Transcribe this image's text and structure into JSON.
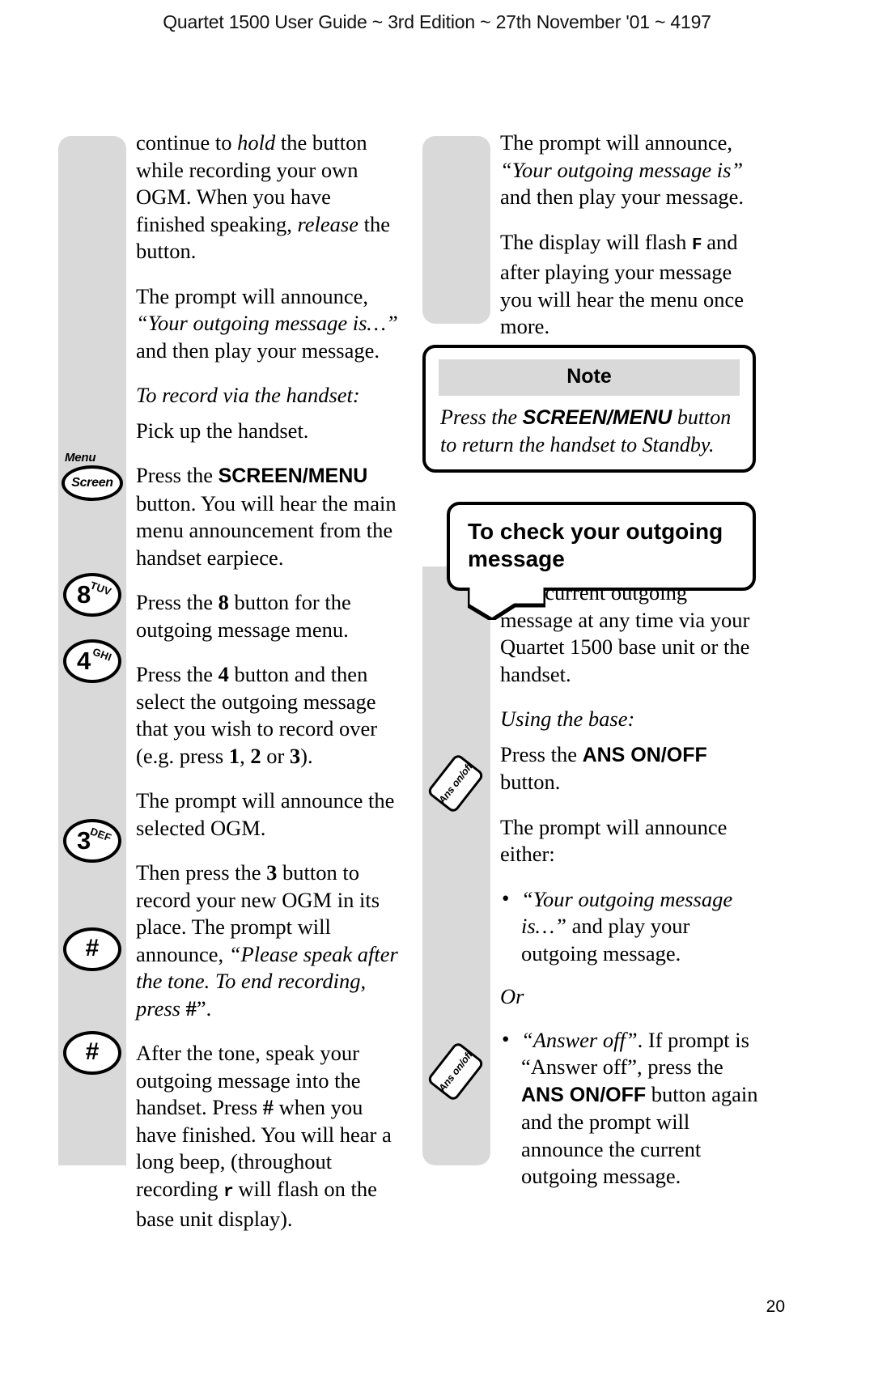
{
  "header": {
    "running_head": "Quartet 1500 User Guide ~ 3rd Edition ~ 27th November '01 ~ 4197"
  },
  "page_number": "20",
  "left_column": {
    "paragraphs": [
      {
        "id": "p1",
        "runs": [
          {
            "text": "continue to ",
            "style": "normal"
          },
          {
            "text": "hold",
            "style": "italic"
          },
          {
            "text": " the button while recording your own OGM. When you have finished speaking, ",
            "style": "normal"
          },
          {
            "text": "release",
            "style": "italic"
          },
          {
            "text": " the button.",
            "style": "normal"
          }
        ]
      },
      {
        "id": "p2",
        "runs": [
          {
            "text": "The prompt will announce, ",
            "style": "normal"
          },
          {
            "text": "“Your outgoing message is…”",
            "style": "italic"
          },
          {
            "text": " and then play your message.",
            "style": "normal"
          }
        ]
      },
      {
        "id": "p3-heading",
        "runs": [
          {
            "text": "To record via the handset:",
            "style": "italic"
          }
        ]
      },
      {
        "id": "p4",
        "runs": [
          {
            "text": "Pick up the handset.",
            "style": "normal"
          }
        ]
      },
      {
        "id": "p5",
        "runs": [
          {
            "text": "Press the ",
            "style": "normal"
          },
          {
            "text": "SCREEN/MENU",
            "style": "sans-bold"
          },
          {
            "text": " button. You will hear the main menu announcement from the handset earpiece.",
            "style": "normal"
          }
        ]
      },
      {
        "id": "p6",
        "runs": [
          {
            "text": "Press the ",
            "style": "normal"
          },
          {
            "text": "8",
            "style": "serif-bold"
          },
          {
            "text": " button for the outgoing message menu.",
            "style": "normal"
          }
        ]
      },
      {
        "id": "p7",
        "runs": [
          {
            "text": "Press the ",
            "style": "normal"
          },
          {
            "text": "4",
            "style": "serif-bold"
          },
          {
            "text": " button and then select the outgoing message that you wish to record over (e.g. press ",
            "style": "normal"
          },
          {
            "text": "1",
            "style": "serif-bold"
          },
          {
            "text": ", ",
            "style": "normal"
          },
          {
            "text": "2",
            "style": "serif-bold"
          },
          {
            "text": " or ",
            "style": "normal"
          },
          {
            "text": "3",
            "style": "serif-bold"
          },
          {
            "text": ").",
            "style": "normal"
          }
        ]
      },
      {
        "id": "p8",
        "runs": [
          {
            "text": "The prompt will announce the selected OGM.",
            "style": "normal"
          }
        ]
      },
      {
        "id": "p9",
        "runs": [
          {
            "text": "Then press the ",
            "style": "normal"
          },
          {
            "text": "3",
            "style": "serif-bold"
          },
          {
            "text": " button to record your new OGM in its place. The prompt will announce, ",
            "style": "normal"
          },
          {
            "text": "“Please speak after the tone. To end recording, press ",
            "style": "italic"
          },
          {
            "text": "#",
            "style": "serif-bold"
          },
          {
            "text": "”.",
            "style": "normal"
          }
        ]
      },
      {
        "id": "p10",
        "runs": [
          {
            "text": "After the tone, speak your outgoing message into the handset. Press ",
            "style": "normal"
          },
          {
            "text": "#",
            "style": "serif-bold"
          },
          {
            "text": " when you have finished. You will hear a long beep, (throughout recording ",
            "style": "normal"
          },
          {
            "text": "r",
            "style": "lcd"
          },
          {
            "text": " will flash on the base unit display).",
            "style": "normal"
          }
        ]
      }
    ],
    "icons": [
      {
        "name": "menu-screen-button-icon",
        "label_top": "Menu",
        "label_oval": "Screen"
      },
      {
        "name": "key-8-icon",
        "digit": "8",
        "letters": "TUV"
      },
      {
        "name": "key-4-icon",
        "digit": "4",
        "letters": "GHI"
      },
      {
        "name": "key-3-icon",
        "digit": "3",
        "letters": "DEF"
      },
      {
        "name": "key-hash-icon",
        "digit": "#",
        "letters": ""
      },
      {
        "name": "key-hash-icon",
        "digit": "#",
        "letters": ""
      }
    ]
  },
  "right_column": {
    "paragraphs_top": [
      {
        "id": "r1",
        "runs": [
          {
            "text": "The prompt will announce, ",
            "style": "normal"
          },
          {
            "text": "“Your outgoing message is”",
            "style": "italic"
          },
          {
            "text": " and then play your message.",
            "style": "normal"
          }
        ]
      },
      {
        "id": "r2",
        "runs": [
          {
            "text": "The display will flash ",
            "style": "normal"
          },
          {
            "text": "F",
            "style": "lcd"
          },
          {
            "text": " and after playing your message you will hear the menu once more.",
            "style": "normal"
          }
        ]
      }
    ],
    "note_box": {
      "title": "Note",
      "runs": [
        {
          "text": "Press the ",
          "style": "italic"
        },
        {
          "text": "SCREEN/MENU",
          "style": "sans-bold"
        },
        {
          "text": " button to return the handset to Standby.",
          "style": "italic"
        }
      ]
    },
    "bubble_heading": "To check your outgoing message",
    "paragraphs_bottom": [
      {
        "id": "r3",
        "runs": [
          {
            "text": "You can check and play back your current outgoing message at any time via your Quartet 1500 base unit or the handset.",
            "style": "normal"
          }
        ]
      },
      {
        "id": "r4-heading",
        "runs": [
          {
            "text": "Using the base:",
            "style": "italic"
          }
        ]
      },
      {
        "id": "r5",
        "runs": [
          {
            "text": "Press the ",
            "style": "normal"
          },
          {
            "text": "ANS ON/OFF",
            "style": "sans-bold"
          },
          {
            "text": " button.",
            "style": "normal"
          }
        ]
      },
      {
        "id": "r6",
        "runs": [
          {
            "text": "The prompt will announce either:",
            "style": "normal"
          }
        ]
      }
    ],
    "bullets_1": [
      {
        "id": "b1",
        "runs": [
          {
            "text": "“Your outgoing message is…”",
            "style": "italic"
          },
          {
            "text": " and play your outgoing message.",
            "style": "normal"
          }
        ]
      }
    ],
    "or_label": "Or",
    "bullets_2": [
      {
        "id": "b2",
        "runs": [
          {
            "text": "“Answer off”",
            "style": "italic"
          },
          {
            "text": ".  If prompt is “Answer off”, press the ",
            "style": "normal"
          },
          {
            "text": "ANS ON/OFF",
            "style": "sans-bold"
          },
          {
            "text": " button again and the prompt will announce the current outgoing message.",
            "style": "normal"
          }
        ]
      }
    ],
    "icons": [
      {
        "name": "ans-on-off-button-icon",
        "label": "Ans on/off"
      },
      {
        "name": "ans-on-off-button-icon",
        "label": "Ans on/off"
      }
    ]
  },
  "colors": {
    "gutter_gray": "#d9d9d9",
    "note_header_gray": "#d9d9d9",
    "ink": "#000000",
    "paper": "#ffffff"
  }
}
